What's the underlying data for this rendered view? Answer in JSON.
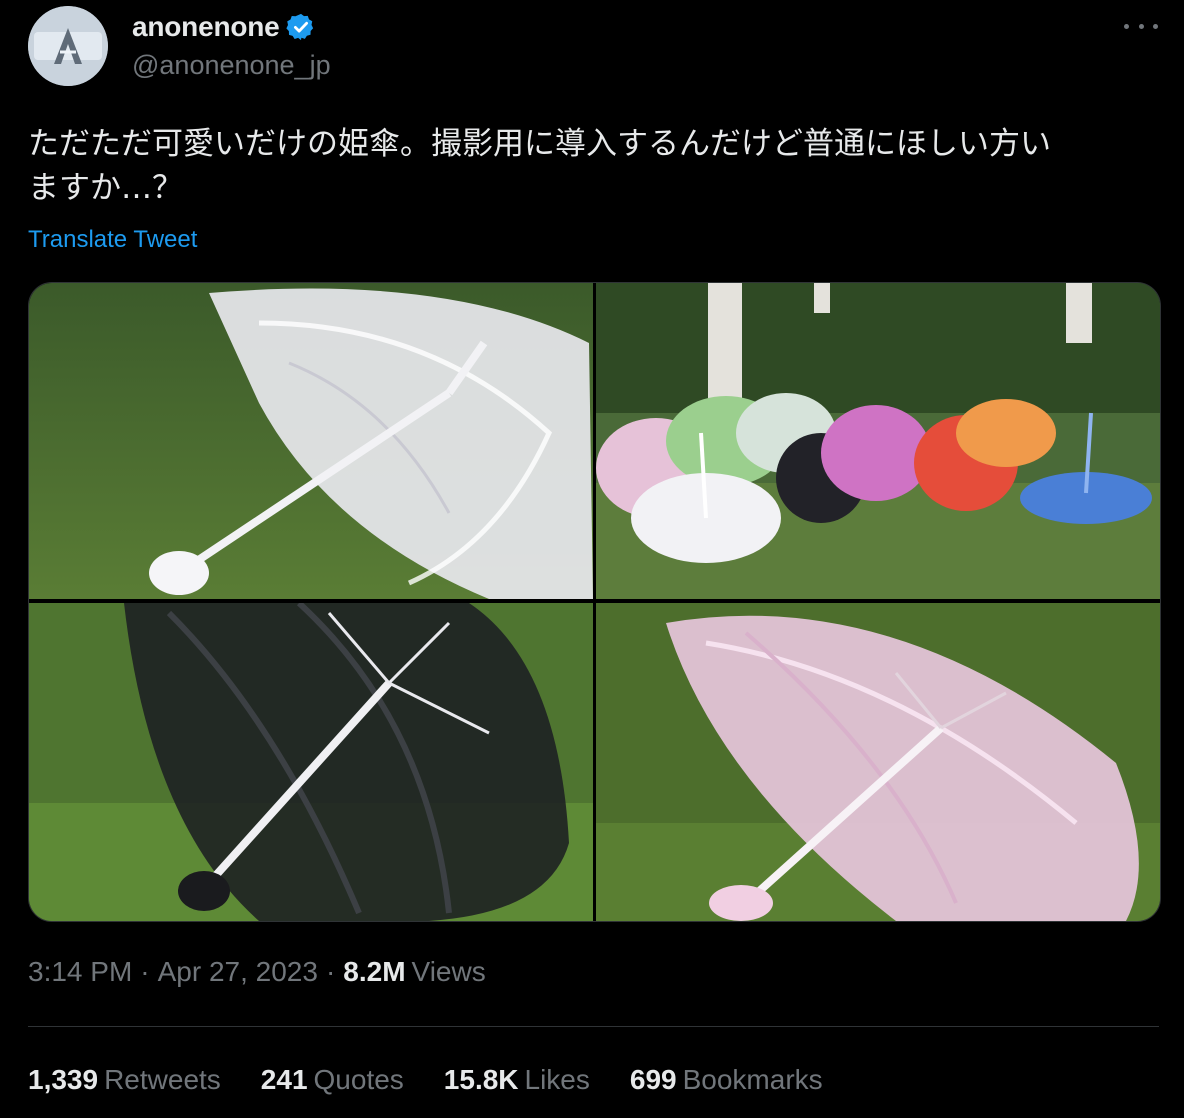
{
  "author": {
    "display_name": "anonenone",
    "handle": "@anonenone_jp",
    "verified": true,
    "avatar_icon": "a-logo-avatar"
  },
  "tweet": {
    "text": "ただただ可愛いだけの姫傘。撮影用に導入するんだけど普通にほしい方い\nますか…？",
    "translate_label": "Translate Tweet",
    "photos": [
      {
        "subject": "white-lace-parasol"
      },
      {
        "subject": "multicolor-lace-parasols"
      },
      {
        "subject": "black-lace-parasol"
      },
      {
        "subject": "pink-lace-parasol"
      }
    ]
  },
  "meta": {
    "time": "3:14 PM",
    "separator": "·",
    "date": "Apr 27, 2023",
    "views_count": "8.2M",
    "views_label": "Views"
  },
  "stats": {
    "retweets": {
      "count": "1,339",
      "label": "Retweets"
    },
    "quotes": {
      "count": "241",
      "label": "Quotes"
    },
    "likes": {
      "count": "15.8K",
      "label": "Likes"
    },
    "bookmarks": {
      "count": "699",
      "label": "Bookmarks"
    }
  },
  "colors": {
    "background": "#000000",
    "text_primary": "#e7e9ea",
    "text_secondary": "#71767b",
    "link": "#1d9bf0",
    "divider": "#2f3336",
    "verified_badge": "#1d9bf0"
  }
}
